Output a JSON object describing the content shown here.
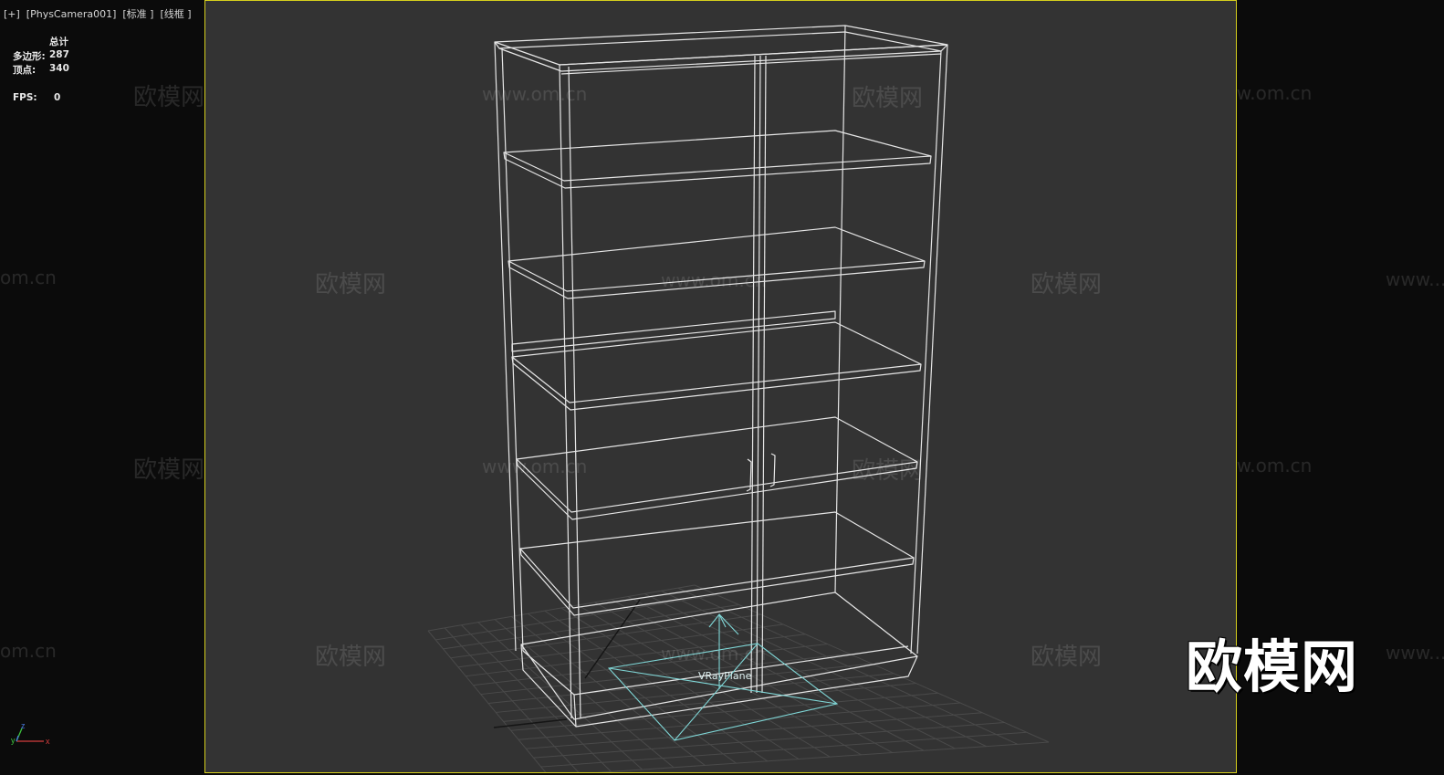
{
  "viewport": {
    "label": "[+]  [PhysCamera001]  [标准 ]  [线框 ]",
    "frame_color": "#d6cf1d",
    "background": "#333333"
  },
  "stats": {
    "header": "总计",
    "polygons_label": "多边形:",
    "polygons_value": "287",
    "vertices_label": "顶点:",
    "vertices_value": "340",
    "fps_label": "FPS:",
    "fps_value": "0"
  },
  "scene": {
    "object_label": "VRayPlane",
    "wire_color": "#e6e6e6",
    "light_color": "#7fd6d6"
  },
  "axis_gizmo": {
    "x": "x",
    "y": "y",
    "z": "z"
  },
  "watermarks": {
    "logo_text": "欧模网",
    "url_text": "www.om.cn",
    "url_partial": "om.cn",
    "url_cut": "www..."
  }
}
